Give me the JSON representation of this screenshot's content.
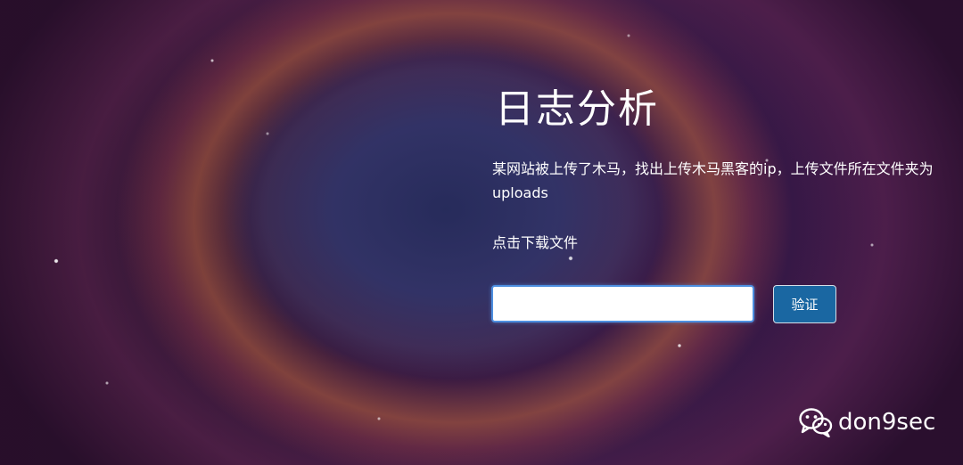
{
  "page": {
    "title": "日志分析",
    "description": "某网站被上传了木马，找出上传木马黑客的ip，上传文件所在文件夹为uploads",
    "download_link": "点击下载文件"
  },
  "form": {
    "answer_input": {
      "value": "",
      "placeholder": ""
    },
    "verify_label": "验证"
  },
  "watermark": {
    "icon": "wechat-icon",
    "text": "don9sec"
  },
  "colors": {
    "button_bg": "#1a67a2",
    "input_border": "#4d8fe0",
    "text": "#ffffff"
  }
}
